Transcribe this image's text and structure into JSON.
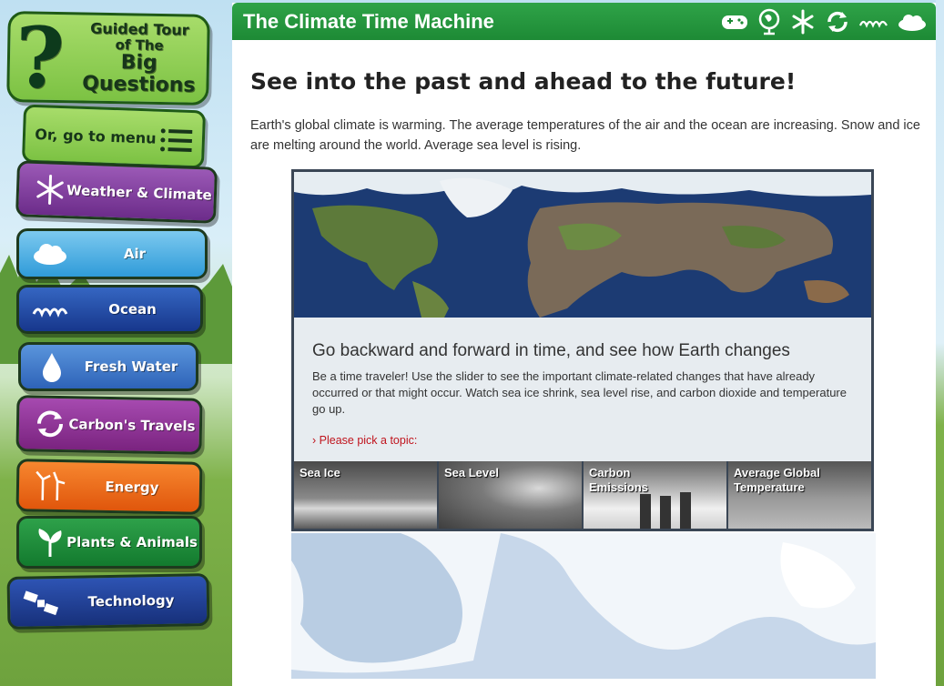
{
  "sidebar": {
    "tour": {
      "line1": "Guided Tour",
      "line2": "of The",
      "line3": "Big",
      "line4": "Questions"
    },
    "menu_label": "Or, go to menu",
    "items": [
      {
        "label": "Weather & Climate",
        "icon": "snowflake-icon",
        "color": "#7a3a96"
      },
      {
        "label": "Air",
        "icon": "cloud-icon",
        "color": "#3ea8e0"
      },
      {
        "label": "Ocean",
        "icon": "waves-icon",
        "color": "#1e4fa6"
      },
      {
        "label": "Fresh Water",
        "icon": "water-drop-icon",
        "color": "#3573c8"
      },
      {
        "label": "Carbon's Travels",
        "icon": "recycle-icon",
        "color": "#8a2f8f"
      },
      {
        "label": "Energy",
        "icon": "wind-turbine-icon",
        "color": "#f06a14"
      },
      {
        "label": "Plants & Animals",
        "icon": "plant-icon",
        "color": "#1f8a38"
      },
      {
        "label": "Technology",
        "icon": "satellite-icon",
        "color": "#1d3a8e"
      }
    ]
  },
  "header": {
    "title": "The Climate Time Machine",
    "icons": [
      "gamepad-icon",
      "globe-icon",
      "snowflake-icon",
      "recycle-icon",
      "waves-icon",
      "cloud-icon"
    ]
  },
  "main": {
    "heading": "See into the past and ahead to the future!",
    "intro": "Earth's global climate is warming. The average temperatures of the air and the ocean are increasing. Snow and ice are melting around the world. Average sea level is rising."
  },
  "interactive": {
    "title": "Go backward and forward in time, and see how Earth changes",
    "body": "Be a time traveler! Use the slider to see the important climate-related changes that have already occurred or that might occur. Watch sea ice shrink, sea level rise, and carbon dioxide and temperature go up.",
    "prompt": "› Please pick a topic:",
    "topics": [
      "Sea Ice",
      "Sea Level",
      "Carbon Emissions",
      "Average Global Temperature"
    ]
  }
}
